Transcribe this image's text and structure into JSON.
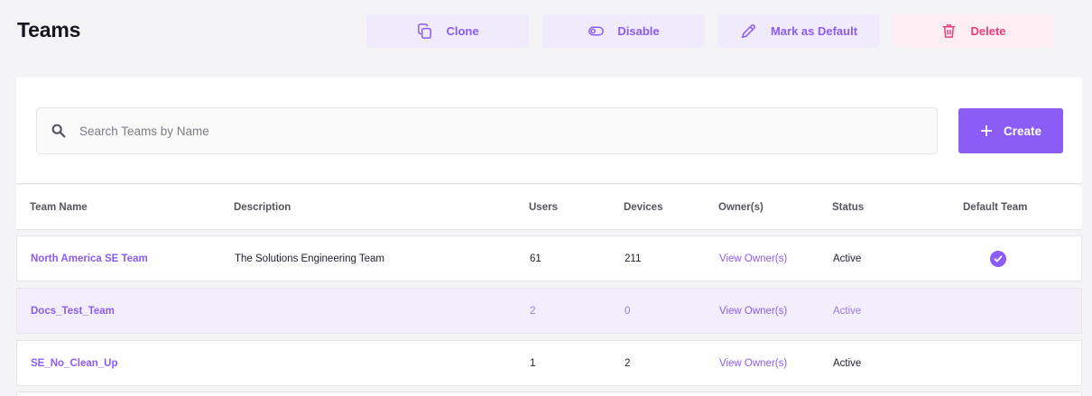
{
  "page": {
    "title": "Teams"
  },
  "actions": {
    "clone": {
      "label": "Clone",
      "icon": "copy-icon"
    },
    "disable": {
      "label": "Disable",
      "icon": "toggle-icon"
    },
    "mark_default": {
      "label": "Mark as Default",
      "icon": "pencil-icon"
    },
    "delete": {
      "label": "Delete",
      "icon": "trash-icon"
    }
  },
  "search": {
    "placeholder": "Search Teams by Name",
    "value": ""
  },
  "create": {
    "label": "Create",
    "icon": "plus-icon"
  },
  "table": {
    "columns": [
      "Team Name",
      "Description",
      "Users",
      "Devices",
      "Owner(s)",
      "Status",
      "Default Team"
    ],
    "rows": [
      {
        "name": "North America SE Team",
        "description": "The Solutions Engineering Team",
        "users": "61",
        "devices": "211",
        "owners": "View Owner(s)",
        "status": "Active",
        "default": true,
        "selected": false
      },
      {
        "name": "Docs_Test_Team",
        "description": "",
        "users": "2",
        "devices": "0",
        "owners": "View Owner(s)",
        "status": "Active",
        "default": false,
        "selected": true
      },
      {
        "name": "SE_No_Clean_Up",
        "description": "",
        "users": "1",
        "devices": "2",
        "owners": "View Owner(s)",
        "status": "Active",
        "default": false,
        "selected": false
      }
    ]
  },
  "colors": {
    "accent": "#8b5cf6",
    "danger": "#ec4079",
    "accent_soft": "#efeafc",
    "danger_soft": "#fdeef3"
  }
}
